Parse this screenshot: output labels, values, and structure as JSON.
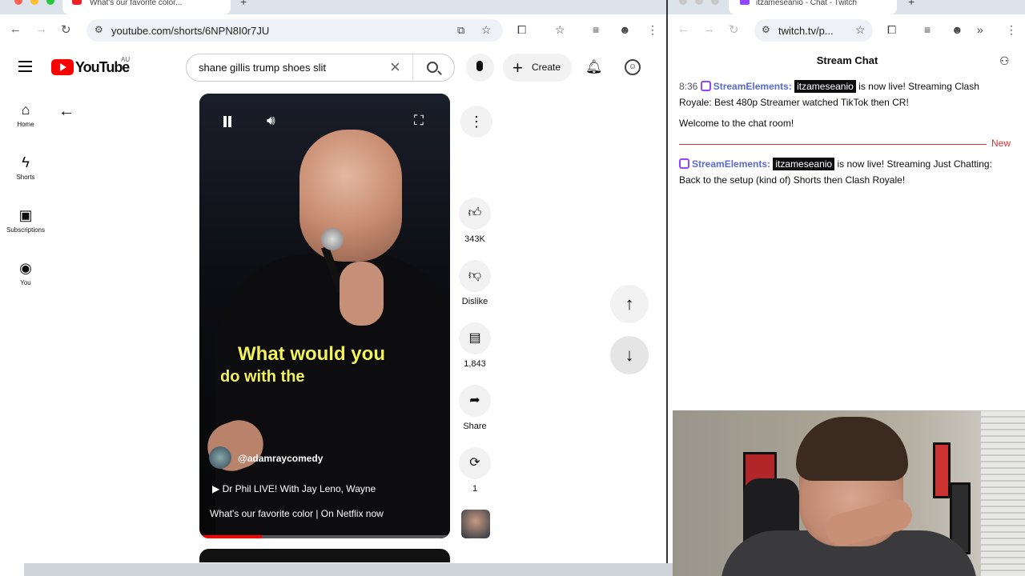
{
  "left_browser": {
    "tab_title": "What's our favorite color...",
    "url": "youtube.com/shorts/6NPN8I0r7JU"
  },
  "youtube": {
    "logo_text": "YouTube",
    "country_code": "AU",
    "search_query": "shane gillis trump shoes slit",
    "create_label": "Create",
    "sidebar": [
      {
        "label": "Home",
        "icon": "home-icon"
      },
      {
        "label": "Shorts",
        "icon": "shorts-icon"
      },
      {
        "label": "Subscriptions",
        "icon": "subscriptions-icon"
      },
      {
        "label": "You",
        "icon": "you-icon"
      }
    ],
    "short": {
      "caption_line1": "What would you",
      "caption_line2": "do with the",
      "channel": "@adamraycomedy",
      "song": "Dr Phil LIVE! With Jay Leno, Wayne",
      "description": "What's our favorite color | On Netflix now",
      "progress": 0.25
    },
    "actions": {
      "likes": "343K",
      "dislike_label": "Dislike",
      "comments": "1,843",
      "share_label": "Share",
      "remix_count": "1"
    }
  },
  "right_browser": {
    "tab_title": "itzameseanio - Chat - Twitch",
    "url": "twitch.tv/p...",
    "chat_title": "Stream Chat",
    "messages": [
      {
        "time": "8:36",
        "user": "StreamElements:",
        "highlight": "itzameseanio",
        "text": "is now live! Streaming Clash Royale: Best 480p Streamer watched TikTok then CR!"
      },
      {
        "text": "Welcome to the chat room!"
      },
      {
        "user": "StreamElements:",
        "highlight": "itzameseanio",
        "text": "is now live! Streaming Just Chatting: Back to the setup (kind of) Shorts then Clash Royale!"
      }
    ],
    "new_label": "New"
  },
  "colors": {
    "youtube_red": "#ff0000",
    "twitch_purple": "#9146ff",
    "streamelements_blue": "#5b6ad6",
    "caption_yellow": "#f3f35a",
    "new_marker_red": "#dd3333"
  }
}
